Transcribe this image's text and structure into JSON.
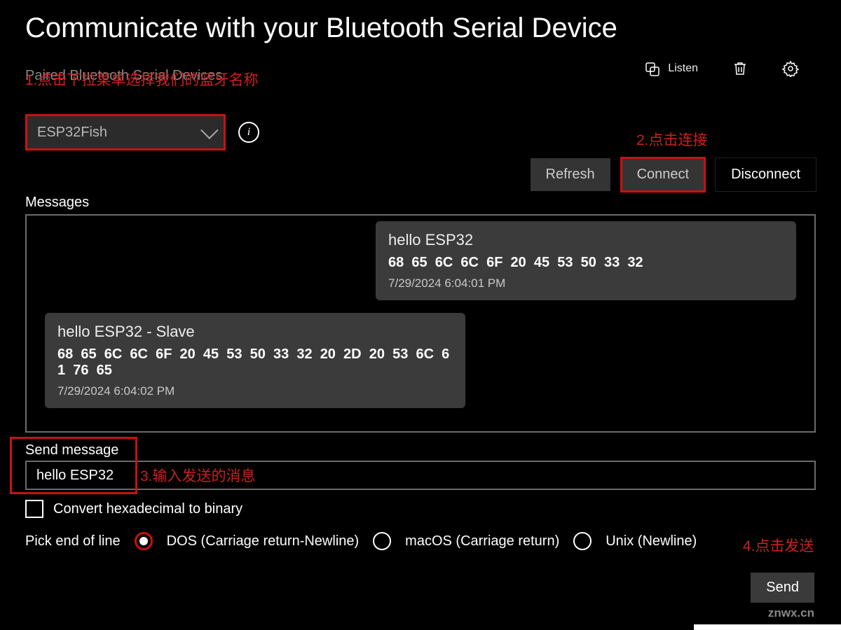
{
  "title": "Communicate with your Bluetooth Serial Device",
  "annotations": {
    "a1": "1.点击下拉菜单选择我们的蓝牙名称",
    "a2": "2.点击连接",
    "a3": "3.输入发送的消息",
    "a4": "4.点击发送"
  },
  "toolbar": {
    "listen": "Listen"
  },
  "devices": {
    "label": "Paired Bluetooth Serial Devices",
    "selected": "ESP32Fish"
  },
  "buttons": {
    "refresh": "Refresh",
    "connect": "Connect",
    "disconnect": "Disconnect",
    "send": "Send"
  },
  "messages": {
    "label": "Messages",
    "items": [
      {
        "direction": "out",
        "text": "hello ESP32",
        "hex": "68  65  6C  6C  6F  20  45  53  50  33  32",
        "timestamp": "7/29/2024 6:04:01 PM"
      },
      {
        "direction": "in",
        "text": "hello ESP32 - Slave",
        "hex": "68  65  6C  6C  6F  20  45  53  50  33  32  20  2D  20  53  6C  61  76  65",
        "timestamp": "7/29/2024 6:04:02 PM"
      }
    ]
  },
  "send": {
    "label": "Send message",
    "value": "hello ESP32"
  },
  "convert": {
    "label": "Convert hexadecimal to binary",
    "checked": false
  },
  "eol": {
    "label": "Pick end of line",
    "options": [
      {
        "label": "DOS (Carriage return-Newline)",
        "selected": true
      },
      {
        "label": "macOS (Carriage return)",
        "selected": false
      },
      {
        "label": "Unix (Newline)",
        "selected": false
      }
    ]
  },
  "watermark": "znwx.cn"
}
